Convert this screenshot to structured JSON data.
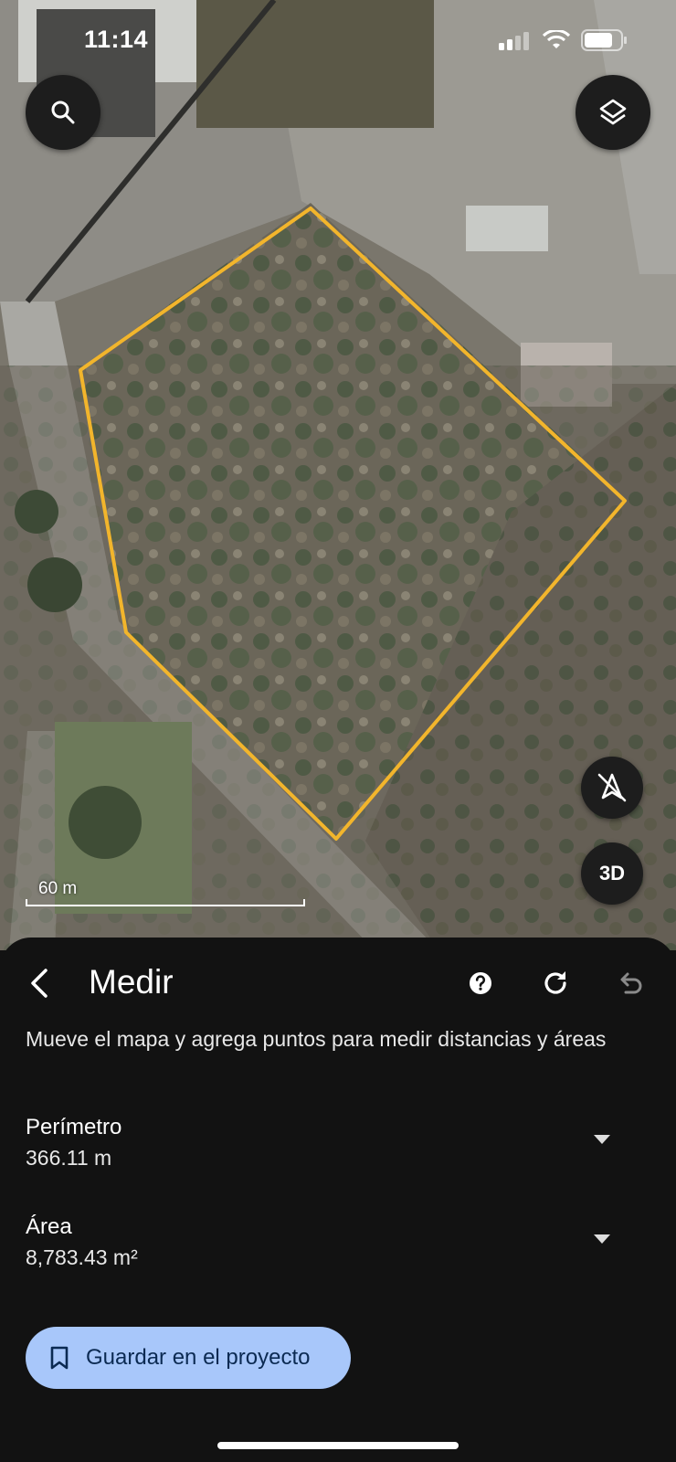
{
  "status_bar": {
    "time": "11:14"
  },
  "map": {
    "scale_label": "60 m",
    "buttons": {
      "search_icon": "search-icon",
      "layers_icon": "layers-icon",
      "north_up_icon": "compass-off-icon",
      "three_d_label": "3D"
    },
    "measure_outline_color": "#f2b52c"
  },
  "sheet": {
    "title": "Medir",
    "instructions": "Mueve el mapa y agrega puntos para medir distancias y áreas",
    "metrics": [
      {
        "label": "Perímetro",
        "value": "366.11 m"
      },
      {
        "label": "Área",
        "value": "8,783.43 m²"
      }
    ],
    "save_button_label": "Guardar en el proyecto",
    "colors": {
      "background": "#121212",
      "button": "#a8c7fa",
      "button_text": "#0b2a52"
    }
  }
}
